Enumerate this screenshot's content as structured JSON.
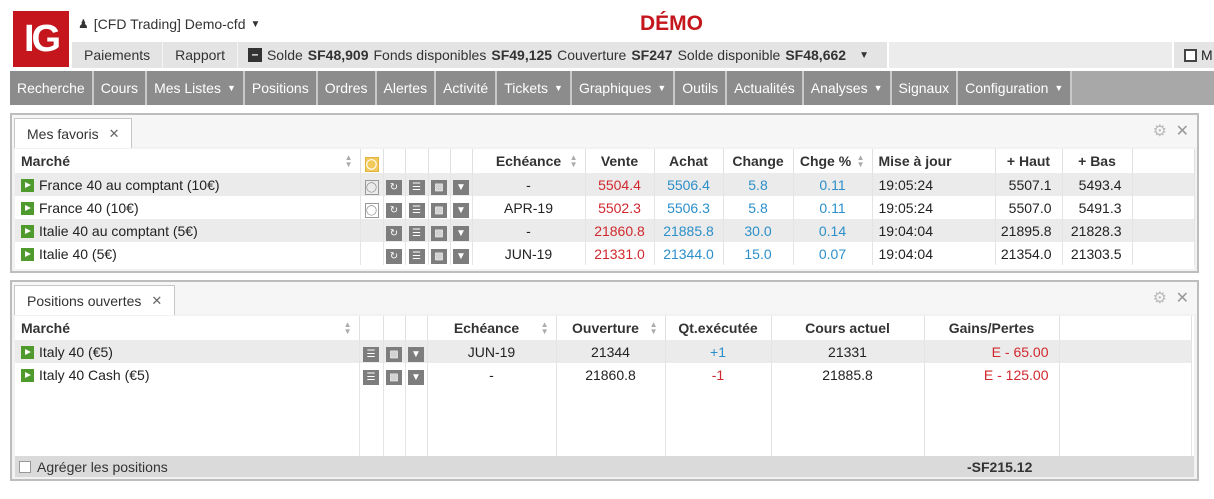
{
  "header": {
    "logo_text": "IG",
    "account_label": "[CFD Trading] Demo-cfd",
    "mode_title": "DÉMO",
    "sub_buttons": [
      "Paiements",
      "Rapport"
    ],
    "balance": {
      "solde_label": "Solde",
      "solde_value": "SF48,909",
      "fonds_label": "Fonds disponibles",
      "fonds_value": "SF49,125",
      "couverture_label": "Couverture",
      "couverture_value": "SF247",
      "solde_dispo_label": "Solde disponible",
      "solde_dispo_value": "SF48,662"
    },
    "right_label": "M"
  },
  "nav": [
    {
      "label": "Recherche",
      "dropdown": false
    },
    {
      "label": "Cours",
      "dropdown": false
    },
    {
      "label": "Mes Listes",
      "dropdown": true
    },
    {
      "label": "Positions",
      "dropdown": false
    },
    {
      "label": "Ordres",
      "dropdown": false
    },
    {
      "label": "Alertes",
      "dropdown": false
    },
    {
      "label": "Activité",
      "dropdown": false
    },
    {
      "label": "Tickets",
      "dropdown": true
    },
    {
      "label": "Graphiques",
      "dropdown": true
    },
    {
      "label": "Outils",
      "dropdown": false
    },
    {
      "label": "Actualités",
      "dropdown": false
    },
    {
      "label": "Analyses",
      "dropdown": true
    },
    {
      "label": "Signaux",
      "dropdown": false
    },
    {
      "label": "Configuration",
      "dropdown": true
    }
  ],
  "favoris": {
    "tab_label": "Mes favoris",
    "columns": {
      "marche": "Marché",
      "echeance": "Echéance",
      "vente": "Vente",
      "achat": "Achat",
      "change": "Change",
      "chge_pct": "Chge %",
      "mise_a_jour": "Mise à jour",
      "haut": "+ Haut",
      "bas": "+ Bas"
    },
    "rows": [
      {
        "marche": "France 40 au comptant (10€)",
        "echeance": "-",
        "vente": "5504.4",
        "achat": "5506.4",
        "change": "5.8",
        "chge_pct": "0.11",
        "mise_a_jour": "19:05:24",
        "haut": "5507.1",
        "bas": "5493.4",
        "bulb": true
      },
      {
        "marche": "France 40 (10€)",
        "echeance": "APR-19",
        "vente": "5502.3",
        "achat": "5506.3",
        "change": "5.8",
        "chge_pct": "0.11",
        "mise_a_jour": "19:05:24",
        "haut": "5507.0",
        "bas": "5491.3",
        "bulb": true
      },
      {
        "marche": "Italie 40 au comptant (5€)",
        "echeance": "-",
        "vente": "21860.8",
        "achat": "21885.8",
        "change": "30.0",
        "chge_pct": "0.14",
        "mise_a_jour": "19:04:04",
        "haut": "21895.8",
        "bas": "21828.3",
        "bulb": false
      },
      {
        "marche": "Italie 40 (5€)",
        "echeance": "JUN-19",
        "vente": "21331.0",
        "achat": "21344.0",
        "change": "15.0",
        "chge_pct": "0.07",
        "mise_a_jour": "19:04:04",
        "haut": "21354.0",
        "bas": "21303.5",
        "bulb": false
      }
    ]
  },
  "positions": {
    "tab_label": "Positions ouvertes",
    "columns": {
      "marche": "Marché",
      "echeance": "Echéance",
      "ouverture": "Ouverture",
      "qt": "Qt.exécutée",
      "cours": "Cours actuel",
      "gains": "Gains/Pertes"
    },
    "rows": [
      {
        "marche": "Italy 40 (€5)",
        "echeance": "JUN-19",
        "ouverture": "21344",
        "qt": "+1",
        "cours": "21331",
        "gains": "E - 65.00"
      },
      {
        "marche": "Italy 40 Cash (€5)",
        "echeance": "-",
        "ouverture": "21860.8",
        "qt": "-1",
        "cours": "21885.8",
        "gains": "E - 125.00"
      }
    ],
    "footer_checkbox_label": "Agréger les positions",
    "total": "-SF215.12"
  },
  "colors": {
    "brand_red": "#c4161c",
    "nav_bg": "#8c8c8c",
    "price_red": "#d0282e",
    "price_blue": "#2b8fc9",
    "market_green": "#4e9a2c"
  }
}
